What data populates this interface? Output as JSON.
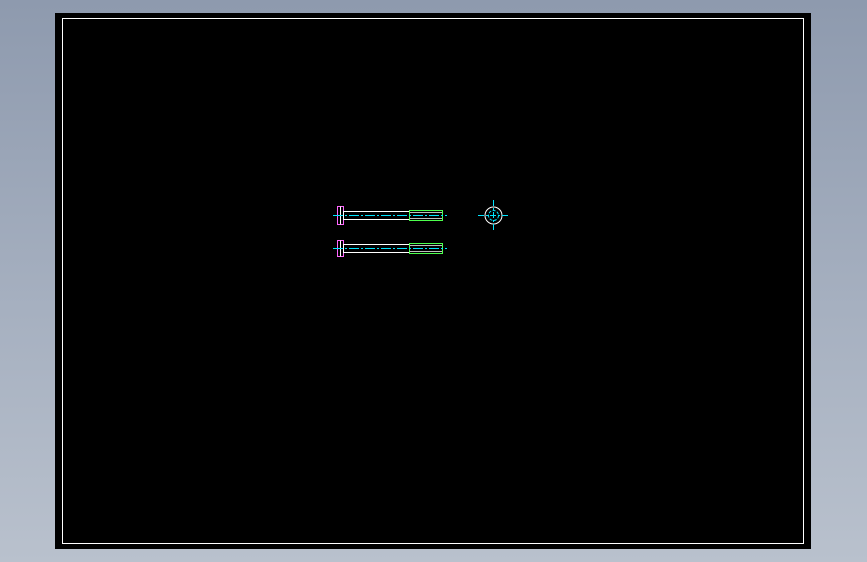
{
  "viewport": {
    "background_gradient": [
      "#8e9aae",
      "#b9c1cd"
    ]
  },
  "sheet": {
    "background": "#000000",
    "border_color": "#ffffff"
  },
  "drawing": {
    "colors": {
      "outline": "#ffffff",
      "centerline": "#00e5ff",
      "thread": "#4dff4d",
      "head": "#ff66ff"
    },
    "views": [
      {
        "name": "bolt-side-view-top"
      },
      {
        "name": "bolt-side-view-bottom"
      },
      {
        "name": "bolt-end-view"
      }
    ]
  }
}
